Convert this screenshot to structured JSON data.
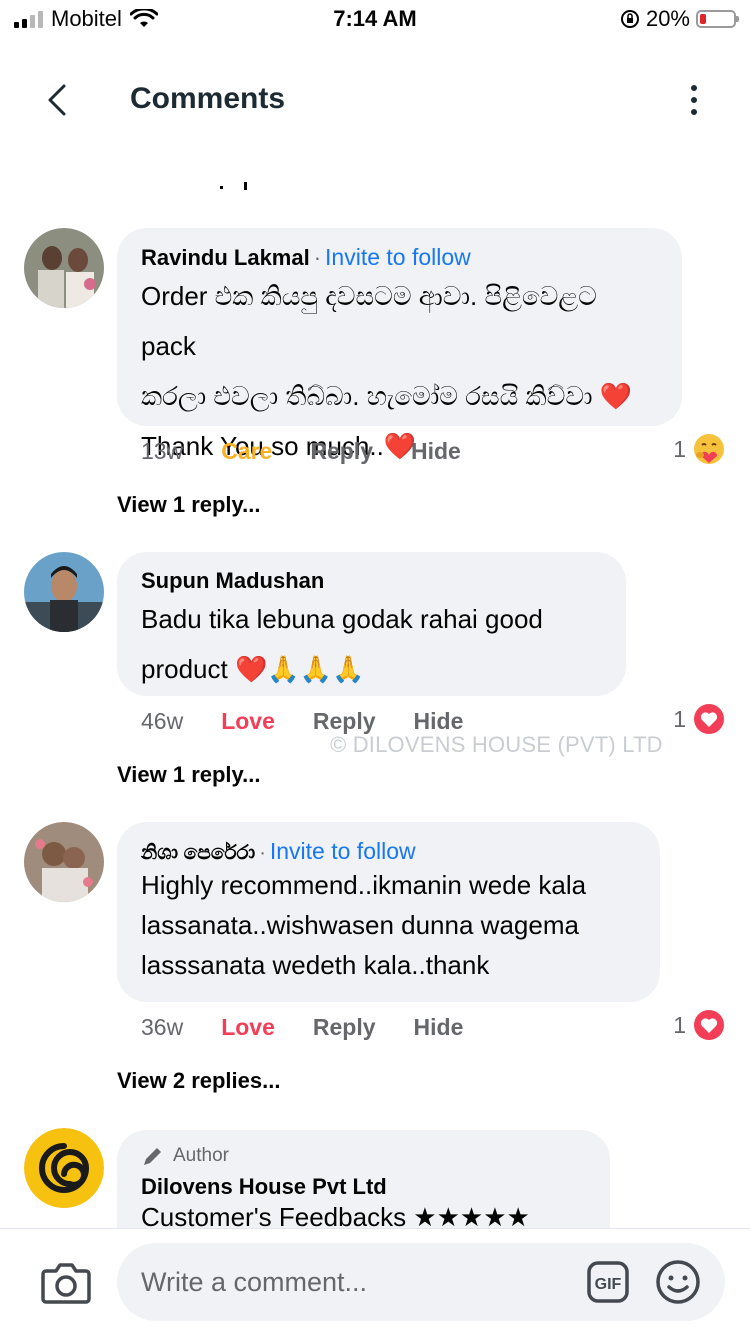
{
  "status": {
    "carrier": "Mobitel",
    "time": "7:14 AM",
    "battery": "20%",
    "battery_level": 0.2
  },
  "header": {
    "title": "Comments"
  },
  "comments": [
    {
      "author": "Ravindu Lakmal",
      "invite": "Invite to follow",
      "lines": [
        "Order එක කියපු දවසටම ආවා. පිළිවෙළට pack",
        "කරලා එවලා තිබ්බා. හැමෝම රසයි කිව්වා ❤️",
        "Thank You so much..❤️"
      ],
      "time": "13w",
      "reaction_label": "Care",
      "reply": "Reply",
      "hide": "Hide",
      "react_count": "1",
      "react_icon": "care-emoji-icon",
      "view_replies": "View 1 reply..."
    },
    {
      "author": "Supun Madushan",
      "invite": "",
      "lines": [
        "Badu tika lebuna  godak  rahai good",
        "product  ❤️🙏🙏🙏"
      ],
      "time": "46w",
      "reaction_label": "Love",
      "reply": "Reply",
      "hide": "Hide",
      "react_count": "1",
      "react_icon": "love-heart-icon",
      "view_replies": "View 1 reply..."
    },
    {
      "author": "නිශා පෙරේරා",
      "invite": "Invite to follow",
      "lines": [
        "Highly recommend..ikmanin wede kala",
        "lassanata..wishwasen dunna wagema",
        "lasssanata wedeth kala..thank"
      ],
      "time": "36w",
      "reaction_label": "Love",
      "reply": "Reply",
      "hide": "Hide",
      "react_count": "1",
      "react_icon": "love-heart-icon",
      "view_replies": "View 2 replies..."
    },
    {
      "badge": "Author",
      "author": "Dilovens House Pvt Ltd",
      "lines": [
        "Customer's Feedbacks ★★★★★"
      ]
    }
  ],
  "watermark": "© DILOVENS HOUSE (PVT) LTD",
  "composer": {
    "placeholder": "Write a comment...",
    "gif": "GIF"
  },
  "colors": {
    "accent": "#1877f2",
    "care": "#f7b125",
    "love": "#f33e58",
    "bubble": "#f0f2f5"
  }
}
